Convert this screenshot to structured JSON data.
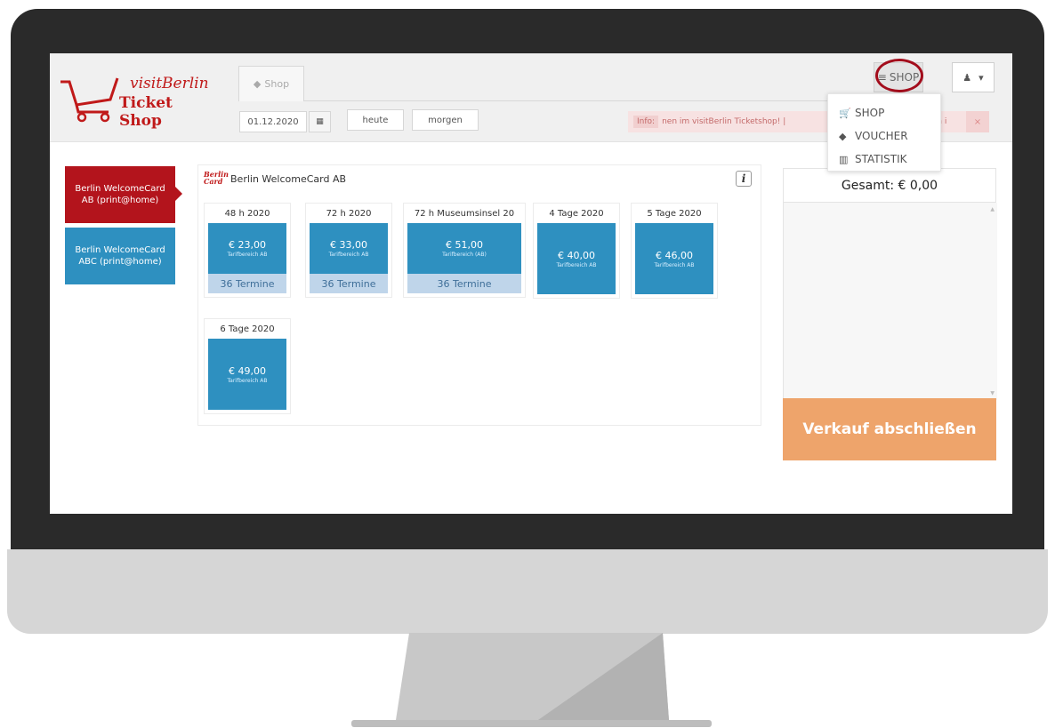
{
  "logo": {
    "line1": "visitBerlin",
    "line2": "Ticket Shop"
  },
  "tab": {
    "label": "Shop"
  },
  "toolbar": {
    "date": "01.12.2020",
    "today_label": "heute",
    "tomorrow_label": "morgen"
  },
  "info": {
    "label": "Info:",
    "text": "nen im visitBerlin Ticketshop! |",
    "tail": "n i",
    "close": "×"
  },
  "menu": {
    "button_label": "SHOP",
    "items": [
      {
        "label": "SHOP",
        "icon": "cart-icon"
      },
      {
        "label": "VOUCHER",
        "icon": "tag-icon"
      },
      {
        "label": "STATISTIK",
        "icon": "bar-chart-icon"
      }
    ]
  },
  "sidebar": {
    "items": [
      {
        "label": "Berlin WelcomeCard AB (print@home)",
        "active": true
      },
      {
        "label": "Berlin WelcomeCard ABC (print@home)",
        "active": false
      }
    ]
  },
  "panel": {
    "title": "Berlin WelcomeCard AB",
    "mini_logo": "Berlin Card"
  },
  "products": [
    {
      "title": "48 h 2020",
      "price": "€ 23,00",
      "zone": "Tarifbereich AB",
      "termine": "36 Termine"
    },
    {
      "title": "72 h 2020",
      "price": "€ 33,00",
      "zone": "Tarifbereich AB",
      "termine": "36 Termine"
    },
    {
      "title": "72 h Museumsinsel 20",
      "price": "€ 51,00",
      "zone": "Tarifbereich (AB)",
      "termine": "36 Termine"
    },
    {
      "title": "4 Tage 2020",
      "price": "€ 40,00",
      "zone": "Tarifbereich AB",
      "termine": ""
    },
    {
      "title": "5 Tage 2020",
      "price": "€ 46,00",
      "zone": "Tarifbereich AB",
      "termine": ""
    },
    {
      "title": "6 Tage 2020",
      "price": "€ 49,00",
      "zone": "Tarifbereich AB",
      "termine": ""
    }
  ],
  "cart": {
    "total": "Gesamt: € 0,00",
    "checkout_label": "Verkauf abschließen"
  },
  "colors": {
    "brand_red": "#b3141c",
    "tile_blue": "#2e90c0",
    "checkout_orange": "#eea46b"
  }
}
